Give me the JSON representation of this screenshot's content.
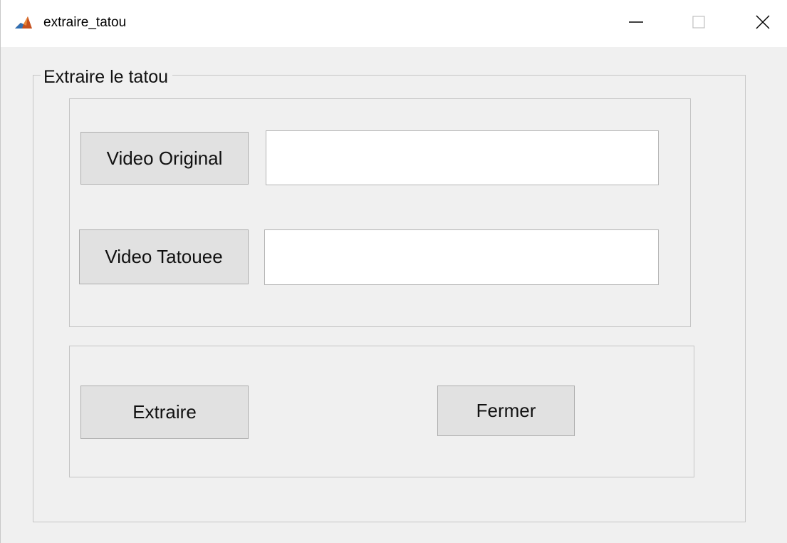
{
  "window": {
    "title": "extraire_tatou",
    "icon": "matlab-icon",
    "controls": {
      "minimize_icon": "minimize-icon",
      "maximize_icon": "maximize-icon",
      "close_icon": "close-icon"
    }
  },
  "group": {
    "title": "Extraire le tatou"
  },
  "inputs_panel": {
    "original_button_label": "Video Original",
    "original_field_value": "",
    "tattooed_button_label": "Video Tatouee",
    "tattooed_field_value": ""
  },
  "actions_panel": {
    "extract_label": "Extraire",
    "close_label": "Fermer"
  },
  "colors": {
    "background": "#f0f0f0",
    "titlebar": "#ffffff",
    "button_face": "#e1e1e1",
    "field": "#ffffff"
  }
}
